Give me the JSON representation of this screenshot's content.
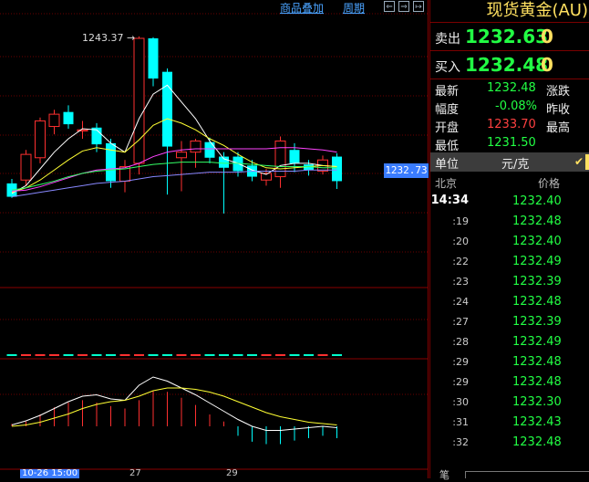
{
  "toolbar": {
    "overlay_label": "商品叠加",
    "period_label": "周期",
    "nav_left": "⇐",
    "nav_right": "⇒",
    "nav_end": "↦"
  },
  "chart": {
    "high_label": "1243.37 →",
    "current_price_tag": "1232.73",
    "start_date": "10-26 15:00",
    "axis_ticks": [
      "27",
      "29"
    ]
  },
  "chart_data": {
    "type": "candlestick",
    "candles": [
      {
        "o": 1230.2,
        "c": 1229.0,
        "h": 1230.6,
        "l": 1228.9,
        "up": false
      },
      {
        "o": 1230.5,
        "c": 1232.8,
        "h": 1233.2,
        "l": 1230.0,
        "up": true
      },
      {
        "o": 1232.5,
        "c": 1235.8,
        "h": 1236.1,
        "l": 1232.0,
        "up": true
      },
      {
        "o": 1235.3,
        "c": 1236.4,
        "h": 1236.8,
        "l": 1234.6,
        "up": true
      },
      {
        "o": 1236.6,
        "c": 1235.5,
        "h": 1237.2,
        "l": 1235.1,
        "up": false
      },
      {
        "o": 1235.0,
        "c": 1234.9,
        "h": 1235.8,
        "l": 1234.2,
        "up": true
      },
      {
        "o": 1235.2,
        "c": 1233.7,
        "h": 1235.6,
        "l": 1233.0,
        "up": false
      },
      {
        "o": 1233.8,
        "c": 1230.4,
        "h": 1234.2,
        "l": 1229.8,
        "up": false
      },
      {
        "o": 1230.4,
        "c": 1231.7,
        "h": 1232.3,
        "l": 1229.4,
        "up": true
      },
      {
        "o": 1232.0,
        "c": 1243.2,
        "h": 1243.37,
        "l": 1231.0,
        "up": true
      },
      {
        "o": 1243.2,
        "c": 1239.6,
        "h": 1243.3,
        "l": 1238.9,
        "up": false
      },
      {
        "o": 1240.2,
        "c": 1233.5,
        "h": 1240.5,
        "l": 1229.2,
        "up": false
      },
      {
        "o": 1233.0,
        "c": 1232.5,
        "h": 1234.0,
        "l": 1229.5,
        "up": true
      },
      {
        "o": 1234.0,
        "c": 1233.0,
        "h": 1234.2,
        "l": 1231.6,
        "up": true
      },
      {
        "o": 1233.9,
        "c": 1232.5,
        "h": 1234.3,
        "l": 1232.0,
        "up": false
      },
      {
        "o": 1232.6,
        "c": 1231.6,
        "h": 1233.0,
        "l": 1227.5,
        "up": false
      },
      {
        "o": 1232.6,
        "c": 1231.3,
        "h": 1233.0,
        "l": 1230.8,
        "up": false
      },
      {
        "o": 1231.8,
        "c": 1230.8,
        "h": 1232.3,
        "l": 1230.4,
        "up": false
      },
      {
        "o": 1231.1,
        "c": 1230.5,
        "h": 1231.5,
        "l": 1230.0,
        "up": true
      },
      {
        "o": 1230.8,
        "c": 1234.0,
        "h": 1234.4,
        "l": 1229.8,
        "up": true
      },
      {
        "o": 1233.2,
        "c": 1232.0,
        "h": 1233.8,
        "l": 1231.2,
        "up": false
      },
      {
        "o": 1231.9,
        "c": 1231.4,
        "h": 1232.3,
        "l": 1230.9,
        "up": false
      },
      {
        "o": 1231.3,
        "c": 1232.3,
        "h": 1232.7,
        "l": 1231.0,
        "up": true
      },
      {
        "o": 1232.6,
        "c": 1230.4,
        "h": 1232.9,
        "l": 1229.7,
        "up": false
      }
    ],
    "ma_lines": [
      {
        "color": "#ffffff",
        "values": [
          1229.3,
          1230.0,
          1231.5,
          1233.0,
          1234.2,
          1235.1,
          1235.0,
          1233.8,
          1233.0,
          1236.0,
          1238.2,
          1239.0,
          1237.5,
          1236.0,
          1234.0,
          1232.4,
          1232.0,
          1231.4,
          1231.0,
          1231.8,
          1232.0,
          1232.0,
          1231.8,
          1231.7
        ]
      },
      {
        "color": "#ffff33",
        "values": [
          1229.4,
          1229.8,
          1230.5,
          1231.4,
          1232.3,
          1233.1,
          1233.4,
          1233.2,
          1233.0,
          1234.1,
          1235.4,
          1236.0,
          1235.6,
          1235.0,
          1234.2,
          1233.6,
          1232.8,
          1232.1,
          1231.6,
          1231.5,
          1231.6,
          1231.7,
          1231.8,
          1231.7
        ]
      },
      {
        "color": "#ff44ff",
        "values": [
          1229.5,
          1229.6,
          1229.9,
          1230.3,
          1230.7,
          1231.1,
          1231.4,
          1231.5,
          1231.6,
          1232.0,
          1232.6,
          1233.0,
          1233.2,
          1233.3,
          1233.3,
          1233.3,
          1233.3,
          1233.3,
          1233.3,
          1233.4,
          1233.4,
          1233.3,
          1233.2,
          1233.0
        ]
      },
      {
        "color": "#33ff66",
        "values": [
          1229.6,
          1229.8,
          1230.1,
          1230.4,
          1230.8,
          1231.1,
          1231.3,
          1231.4,
          1231.5,
          1231.7,
          1231.9,
          1232.0,
          1232.1,
          1232.1,
          1232.1,
          1232.0,
          1232.0,
          1231.9,
          1231.8,
          1231.7,
          1231.7,
          1231.7,
          1231.6,
          1231.6
        ]
      },
      {
        "color": "#8888ff",
        "values": [
          1229.0,
          1229.2,
          1229.4,
          1229.6,
          1229.8,
          1230.0,
          1230.2,
          1230.3,
          1230.4,
          1230.6,
          1230.8,
          1230.9,
          1231.0,
          1231.1,
          1231.2,
          1231.2,
          1231.2,
          1231.3,
          1231.3,
          1231.3,
          1231.3,
          1231.4,
          1231.4,
          1231.4
        ]
      }
    ],
    "macd_hist": [
      0.2,
      0.4,
      1.0,
      1.6,
      2.0,
      2.2,
      2.0,
      1.7,
      1.5,
      2.2,
      3.0,
      2.9,
      2.4,
      1.8,
      1.0,
      0.4,
      -0.8,
      -1.3,
      -1.5,
      -1.5,
      -1.2,
      -1.0,
      -0.8,
      -1.0
    ],
    "macd_dif": [
      0.1,
      0.4,
      0.8,
      1.3,
      1.8,
      2.2,
      2.3,
      2.0,
      1.9,
      3.0,
      3.6,
      3.3,
      2.8,
      2.3,
      1.7,
      1.1,
      0.5,
      0.0,
      -0.3,
      -0.3,
      -0.2,
      -0.1,
      0.0,
      -0.1
    ],
    "macd_dea": [
      0.0,
      0.1,
      0.3,
      0.6,
      0.9,
      1.3,
      1.6,
      1.8,
      1.9,
      2.2,
      2.6,
      2.8,
      2.8,
      2.7,
      2.5,
      2.2,
      1.8,
      1.4,
      1.0,
      0.7,
      0.5,
      0.3,
      0.2,
      0.1
    ]
  },
  "panel": {
    "title": "现货黄金(AU)",
    "sell_label": "卖出",
    "sell_price": "1232.63",
    "sell_vol": "0",
    "buy_label": "买入",
    "buy_price": "1232.48",
    "buy_vol": "0",
    "stats": {
      "latest_label": "最新",
      "latest": "1232.48",
      "change_label": "涨跌",
      "change": "",
      "amplitude_label": "幅度",
      "amplitude": "-0.08%",
      "prev_close_label": "昨收",
      "prev_close": "",
      "open_label": "开盘",
      "open": "1233.70",
      "high_label": "最高",
      "high": "",
      "low_label": "最低",
      "low": "1231.50"
    },
    "unit_label": "单位",
    "unit_value": "元/克",
    "col_time": "北京",
    "col_price": "价格",
    "ticks": [
      {
        "t": "14:34",
        "p": "1232.40"
      },
      {
        "t": ":19",
        "p": "1232.48"
      },
      {
        "t": ":20",
        "p": "1232.40"
      },
      {
        "t": ":22",
        "p": "1232.49"
      },
      {
        "t": ":23",
        "p": "1232.39"
      },
      {
        "t": ":24",
        "p": "1232.48"
      },
      {
        "t": ":27",
        "p": "1232.39"
      },
      {
        "t": ":28",
        "p": "1232.49"
      },
      {
        "t": ":29",
        "p": "1232.48"
      },
      {
        "t": ":29",
        "p": "1232.48"
      },
      {
        "t": ":30",
        "p": "1232.30"
      },
      {
        "t": ":31",
        "p": "1232.43"
      },
      {
        "t": ":32",
        "p": "1232.48"
      }
    ],
    "footer_label": "笔"
  }
}
